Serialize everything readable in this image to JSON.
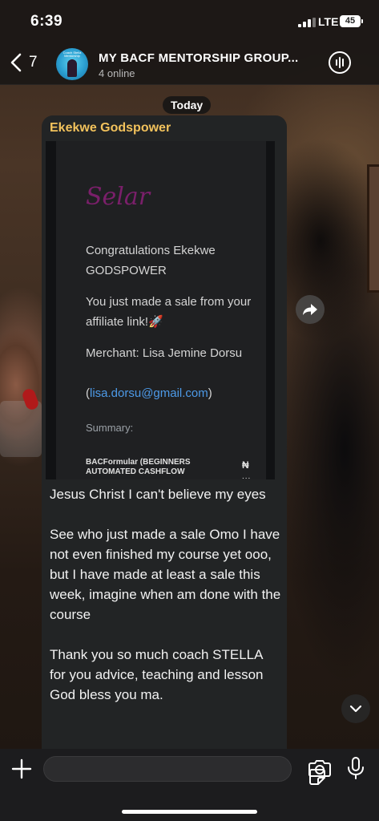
{
  "status_bar": {
    "time": "6:39",
    "network": "LTE",
    "battery": "45"
  },
  "header": {
    "back_count": "7",
    "title": "MY BACF MENTORSHIP GROUP...",
    "subtitle": "4 online",
    "avatar_text": "Coach Stella Mentorship"
  },
  "date_label": "Today",
  "message": {
    "sender": "Ekekwe Godspower",
    "sender_color": "#f2c25c",
    "image": {
      "logo": "Selar",
      "line1": "Congratulations Ekekwe GODSPOWER",
      "line2": "You just made a sale from your affiliate link!🚀",
      "merchant": "Merchant: Lisa Jemine Dorsu",
      "email": "lisa.dorsu@gmail.com",
      "summary_label": "Summary:",
      "product": "BACFormular (BEGINNERS AUTOMATED CASHFLOW",
      "currency": "₦",
      "more": "..."
    },
    "paragraphs": [
      "Jesus Christ I can't believe my eyes",
      "See who just made a sale Omo I have not even finished my course yet ooo, but I have made at least a sale this week, imagine when am done with the course",
      "Thank you so much coach STELLA for you advice, teaching and lesson God bless you ma."
    ]
  },
  "composer": {
    "placeholder": ""
  },
  "icons": [
    "back-chevron-icon",
    "voice-chat-icon",
    "forward-icon",
    "chevron-down-icon",
    "plus-icon",
    "sticker-icon",
    "camera-icon",
    "mic-icon"
  ]
}
